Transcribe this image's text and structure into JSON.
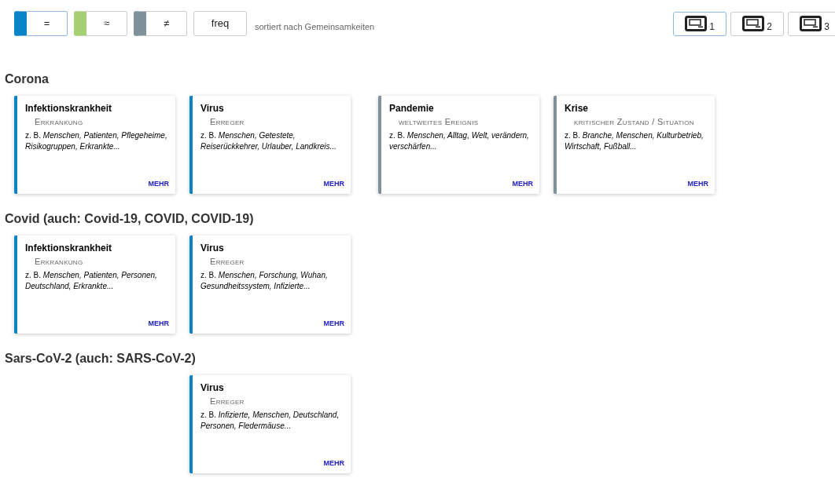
{
  "filters": [
    {
      "label": "=",
      "color": "#0a84c8",
      "selected": true
    },
    {
      "label": "≈",
      "color": "#a6d074",
      "selected": false
    },
    {
      "label": "≠",
      "color": "#7f9299",
      "selected": false
    },
    {
      "label": "freq",
      "selected": false
    }
  ],
  "sort_label": "sortiert nach Gemeinsamkeiten",
  "views": [
    {
      "label": "1",
      "selected": true
    },
    {
      "label": "2",
      "selected": false
    },
    {
      "label": "3",
      "selected": false
    }
  ],
  "sections": [
    {
      "title": "Corona",
      "slots": [
        {
          "kind": "card",
          "title": "Infektionskrankheit",
          "subtitle": "Erkrankung",
          "examples": "z. B. *Menschen, Patienten, Pflegeheime, Risikogruppen, Erkrankte...*",
          "more": "MEHR",
          "color": "#0a84c8"
        },
        {
          "kind": "card",
          "title": "Virus",
          "subtitle": "Erreger",
          "examples": "z. B. *Menschen, Getestete, Reiserückkehrer, Urlauber, Landkreis...*",
          "more": "MEHR",
          "color": "#0a84c8"
        },
        {
          "kind": "card",
          "title": "Pandemie",
          "subtitle": "weltweites Ereignis",
          "examples": "z. B. *Menschen, Alltag, Welt, verändern, verschärfen...*",
          "more": "MEHR",
          "color": "#7f9299"
        },
        {
          "kind": "card",
          "title": "Krise",
          "subtitle": "kritischer Zustand / Situation",
          "examples": "z. B. *Branche, Menschen, Kulturbetrieb, Wirtschaft, Fußball...*",
          "more": "MEHR",
          "color": "#7f9299"
        }
      ]
    },
    {
      "title": "Covid (auch: Covid-19, COVID, COVID-19)",
      "slots": [
        {
          "kind": "card",
          "title": "Infektionskrankheit",
          "subtitle": "Erkrankung",
          "examples": "z. B. *Menschen, Patienten, Personen, Deutschland, Erkrankte...*",
          "more": "MEHR",
          "color": "#0a84c8"
        },
        {
          "kind": "card",
          "title": "Virus",
          "subtitle": "Erreger",
          "examples": "z. B. *Menschen, Forschung, Wuhan, Gesundheitssystem, Infizierte...*",
          "more": "MEHR",
          "color": "#0a84c8"
        }
      ]
    },
    {
      "title": "Sars-CoV-2 (auch: SARS-CoV-2)",
      "slots": [
        {
          "kind": "empty"
        },
        {
          "kind": "card",
          "title": "Virus",
          "subtitle": "Erreger",
          "examples": "z. B. *Infizierte, Menschen, Deutschland, Personen, Fledermäuse...*",
          "more": "MEHR",
          "color": "#0a84c8"
        }
      ]
    }
  ]
}
